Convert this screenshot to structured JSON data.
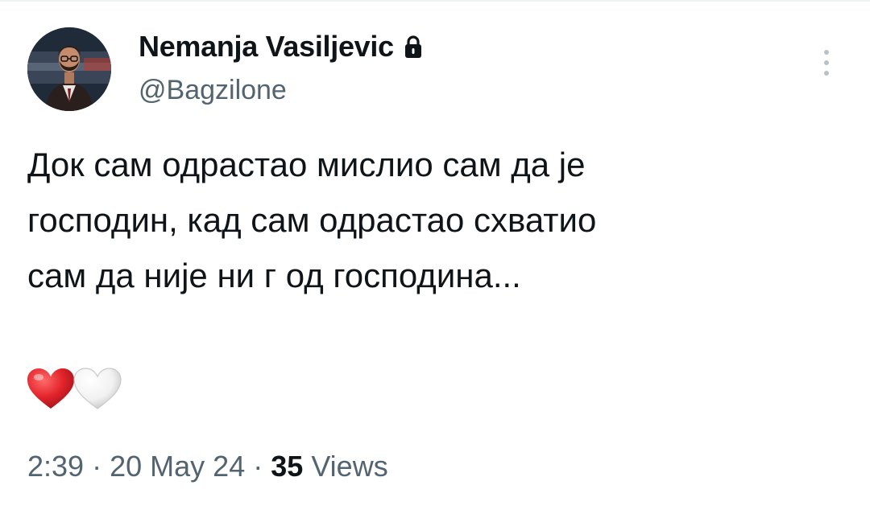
{
  "author": {
    "display_name": "Nemanja Vasiljevic",
    "handle": "@Bagzilone",
    "protected": true
  },
  "tweet": {
    "lines": [
      "Док сам одрастао мислио сам да је",
      "господин, кад сам одрастао схватио",
      "сам да није ни г од господина..."
    ],
    "emojis": [
      "red-heart",
      "white-heart"
    ]
  },
  "meta": {
    "time": "2:39",
    "separator": "·",
    "date": "20 May 24",
    "views_count": "35",
    "views_label": "Views"
  },
  "colors": {
    "text_primary": "#0f1419",
    "text_secondary": "#536471",
    "heart_red": "#e3242b",
    "more_dots": "#b8c1c8"
  },
  "icons": {
    "lock": "lock-icon",
    "more": "more-vertical-icon"
  }
}
